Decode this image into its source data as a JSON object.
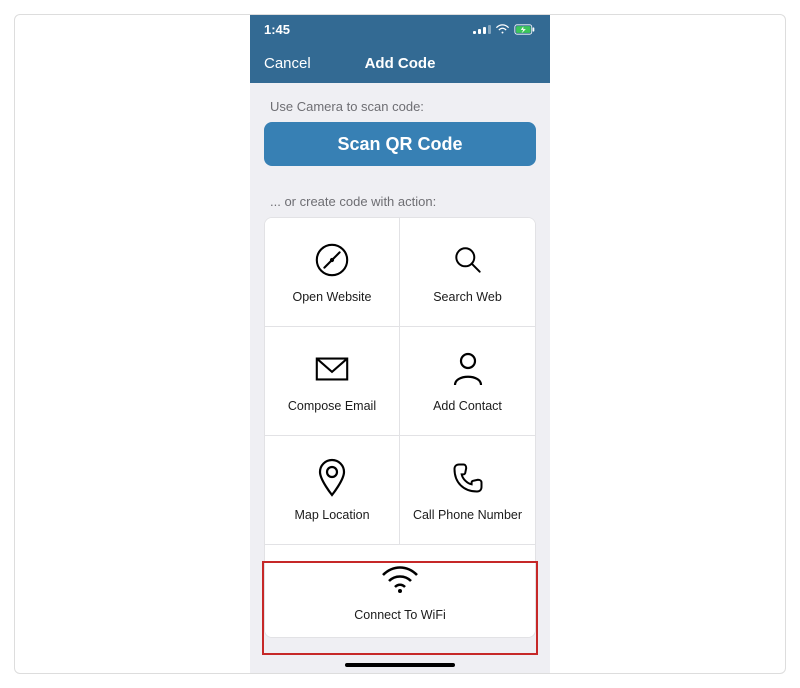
{
  "statusbar": {
    "time": "1:45"
  },
  "nav": {
    "cancel": "Cancel",
    "title": "Add Code"
  },
  "content": {
    "scan_hint": "Use Camera to scan code:",
    "scan_button": "Scan QR Code",
    "create_hint": "... or create code with action:"
  },
  "actions": {
    "open_website": "Open Website",
    "search_web": "Search Web",
    "compose_email": "Compose Email",
    "add_contact": "Add Contact",
    "map_location": "Map Location",
    "call_phone": "Call Phone Number",
    "connect_wifi": "Connect To WiFi"
  },
  "colors": {
    "navbar_bg": "#336a93",
    "button_bg": "#3780b4",
    "page_bg": "#efeff3",
    "highlight": "#c62828"
  }
}
